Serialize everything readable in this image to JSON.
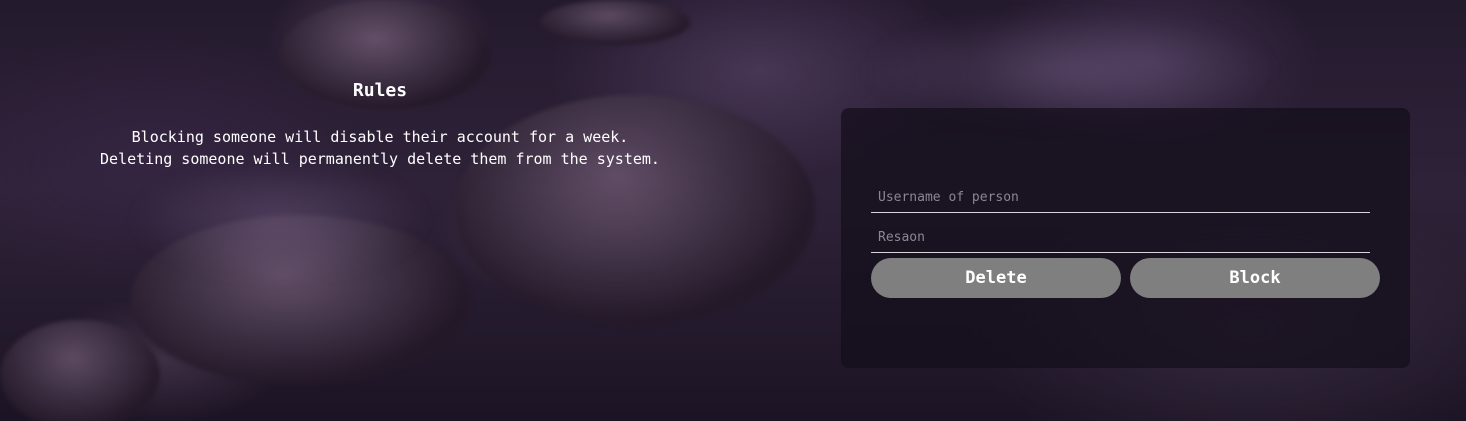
{
  "rules": {
    "title": "Rules",
    "lines": [
      "Blocking someone will disable their account for a week.",
      "Deleting someone will permanently delete them from the system."
    ]
  },
  "form": {
    "username_placeholder": "Username of person",
    "reason_placeholder": "Resaon",
    "delete_label": "Delete",
    "block_label": "Block"
  },
  "colors": {
    "panel_background": "#140e1a",
    "button_background": "#7f7f80",
    "button_text": "#ffffff",
    "text": "#ffffff"
  }
}
